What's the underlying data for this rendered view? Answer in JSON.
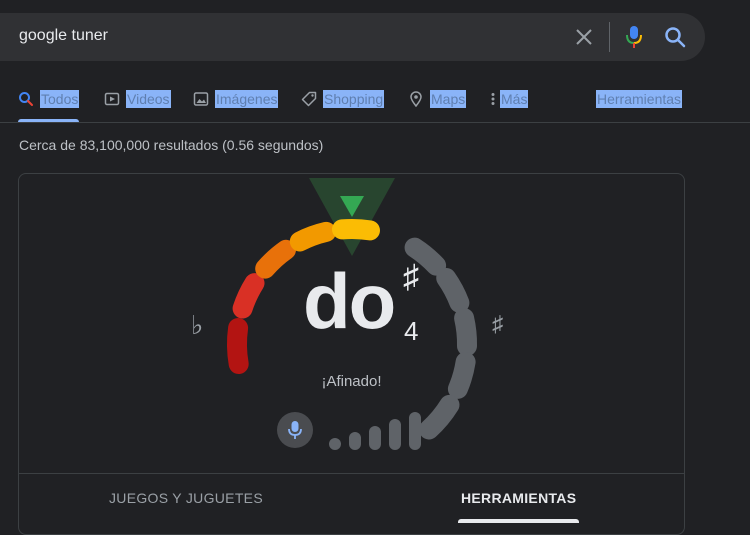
{
  "search": {
    "query": "google tuner"
  },
  "tabs": [
    {
      "label": "Todos",
      "icon": "search-icon",
      "active": true
    },
    {
      "label": "Videos",
      "icon": "video-icon"
    },
    {
      "label": "Imágenes",
      "icon": "image-icon"
    },
    {
      "label": "Shopping",
      "icon": "tag-icon"
    },
    {
      "label": "Maps",
      "icon": "map-pin-icon"
    },
    {
      "label": "Más",
      "icon": "more-vert-icon"
    },
    {
      "label": "Herramientas"
    }
  ],
  "results_stats": "Cerca de 83,100,000 resultados (0.56 segundos)",
  "tuner": {
    "note": "do",
    "accidental": "♯",
    "octave": "4",
    "flat_symbol": "♭",
    "sharp_symbol": "♯",
    "status": "¡Afinado!",
    "mic_level": 0.8,
    "colors": {
      "warm_segments": [
        "#b31412",
        "#d93025",
        "#e8710a",
        "#f29900",
        "#fbbc04"
      ],
      "inactive_segment": "#5f6368",
      "indicator": "#34a853"
    }
  },
  "card_tabs": {
    "games": "JUEGOS Y JUGUETES",
    "tools": "HERRAMIENTAS",
    "active": "tools"
  },
  "colors": {
    "background": "#202124",
    "accent": "#8ab4f8"
  }
}
